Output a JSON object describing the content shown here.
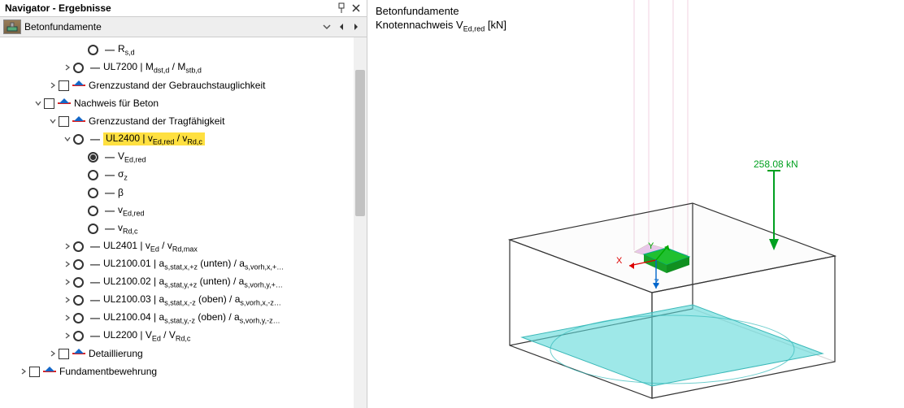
{
  "navigator": {
    "title": "Navigator - Ergebnisse",
    "selector_label": "Betonfundamente"
  },
  "tree": {
    "items": [
      {
        "indent": 5,
        "chev": "",
        "kind": "radio",
        "label": "R<sub>s,d</sub>"
      },
      {
        "indent": 4,
        "chev": ">",
        "kind": "radio",
        "label": "UL7200 | M<sub>dst,d</sub> / M<sub>stb,d</sub>"
      },
      {
        "indent": 3,
        "chev": ">",
        "kind": "cbox_flag",
        "label": "Grenzzustand der Gebrauchstauglichkeit"
      },
      {
        "indent": 2,
        "chev": "v",
        "kind": "cbox_flag",
        "label": "Nachweis für Beton"
      },
      {
        "indent": 3,
        "chev": "v",
        "kind": "cbox_flag",
        "label": "Grenzzustand der Tragfähigkeit"
      },
      {
        "indent": 4,
        "chev": "v",
        "kind": "radio",
        "label": "UL2400 | v<sub>Ed,red</sub> / v<sub>Rd,c</sub>",
        "hl": true
      },
      {
        "indent": 5,
        "chev": "",
        "kind": "radio_sel",
        "label": "V<sub>Ed,red</sub>"
      },
      {
        "indent": 5,
        "chev": "",
        "kind": "radio",
        "label": "σ<sub>z</sub>"
      },
      {
        "indent": 5,
        "chev": "",
        "kind": "radio",
        "label": "β"
      },
      {
        "indent": 5,
        "chev": "",
        "kind": "radio",
        "label": "v<sub>Ed,red</sub>"
      },
      {
        "indent": 5,
        "chev": "",
        "kind": "radio",
        "label": "v<sub>Rd,c</sub>"
      },
      {
        "indent": 4,
        "chev": ">",
        "kind": "radio",
        "label": "UL2401 | v<sub>Ed</sub> / v<sub>Rd,max</sub>"
      },
      {
        "indent": 4,
        "chev": ">",
        "kind": "radio",
        "label": "UL2100.01 | a<sub>s,stat,x,+z</sub> (unten) / a<sub>s,vorh,x,+…</sub>"
      },
      {
        "indent": 4,
        "chev": ">",
        "kind": "radio",
        "label": "UL2100.02 | a<sub>s,stat,y,+z</sub> (unten) / a<sub>s,vorh,y,+…</sub>"
      },
      {
        "indent": 4,
        "chev": ">",
        "kind": "radio",
        "label": "UL2100.03 | a<sub>s,stat,x,-z</sub> (oben) / a<sub>s,vorh,x,-z…</sub>"
      },
      {
        "indent": 4,
        "chev": ">",
        "kind": "radio",
        "label": "UL2100.04 | a<sub>s,stat,y,-z</sub> (oben) / a<sub>s,vorh,y,-z…</sub>"
      },
      {
        "indent": 4,
        "chev": ">",
        "kind": "radio",
        "label": "UL2200 | V<sub>Ed</sub> / V<sub>Rd,c</sub>"
      },
      {
        "indent": 3,
        "chev": ">",
        "kind": "cbox_flag",
        "label": "Detaillierung"
      },
      {
        "indent": 1,
        "chev": ">",
        "kind": "cbox_flag",
        "label": "Fundamentbewehrung"
      }
    ]
  },
  "viewport": {
    "title": "Betonfundamente",
    "subtitle": "Knotennachweis V<sub>Ed,red</sub> [kN]",
    "load_value": "258.08 kN",
    "axis_x": "X",
    "axis_y": "Y",
    "axis_z": "Z"
  }
}
